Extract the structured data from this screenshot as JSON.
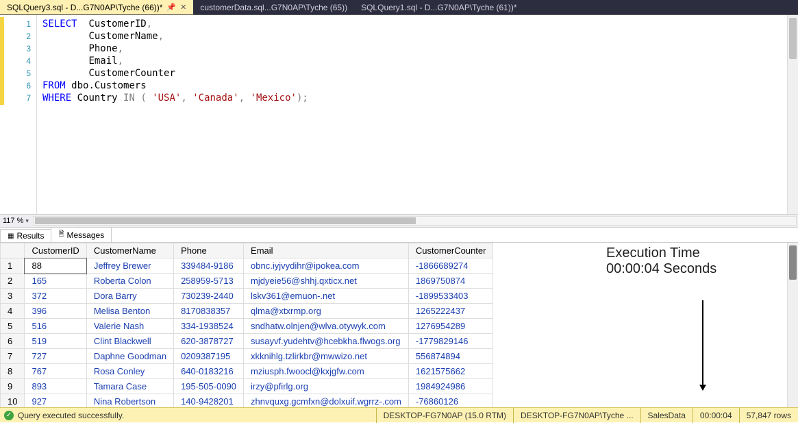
{
  "tabs": [
    {
      "label": "SQLQuery3.sql - D...G7N0AP\\Tyche (66))*",
      "active": true,
      "pinned": true
    },
    {
      "label": "customerData.sql...G7N0AP\\Tyche (65))",
      "active": false,
      "pinned": false
    },
    {
      "label": "SQLQuery1.sql - D...G7N0AP\\Tyche (61))*",
      "active": false,
      "pinned": false
    }
  ],
  "editor": {
    "lines": [
      1,
      2,
      3,
      4,
      5,
      6,
      7
    ],
    "sql": {
      "select": "SELECT",
      "cols": [
        "CustomerID",
        "CustomerName",
        "Phone",
        "Email",
        "CustomerCounter"
      ],
      "from": "FROM",
      "table": "dbo.Customers",
      "where": "WHERE",
      "whereCol": "Country",
      "in": "IN",
      "vals": [
        "'USA'",
        "'Canada'",
        "'Mexico'"
      ]
    }
  },
  "zoom": {
    "value": "117 %"
  },
  "resultsTabs": {
    "results": "Results",
    "messages": "Messages"
  },
  "grid": {
    "headers": [
      "",
      "CustomerID",
      "CustomerName",
      "Phone",
      "Email",
      "CustomerCounter"
    ],
    "rows": [
      {
        "n": "1",
        "CustomerID": "88",
        "CustomerName": "Jeffrey Brewer",
        "Phone": "339484-9186",
        "Email": "obnc.iyjvydihr@ipokea.com",
        "CustomerCounter": "-1866689274"
      },
      {
        "n": "2",
        "CustomerID": "165",
        "CustomerName": "Roberta Colon",
        "Phone": "258959-5713",
        "Email": "mjdyeie56@shhj.qxticx.net",
        "CustomerCounter": "1869750874"
      },
      {
        "n": "3",
        "CustomerID": "372",
        "CustomerName": "Dora Barry",
        "Phone": "730239-2440",
        "Email": "lskv361@emuon-.net",
        "CustomerCounter": "-1899533403"
      },
      {
        "n": "4",
        "CustomerID": "396",
        "CustomerName": "Melisa Benton",
        "Phone": "8170838357",
        "Email": "qlma@xtxrmp.org",
        "CustomerCounter": "1265222437"
      },
      {
        "n": "5",
        "CustomerID": "516",
        "CustomerName": "Valerie Nash",
        "Phone": "334-1938524",
        "Email": "sndhatw.olnjen@wlva.otywyk.com",
        "CustomerCounter": "1276954289"
      },
      {
        "n": "6",
        "CustomerID": "519",
        "CustomerName": "Clint Blackwell",
        "Phone": "620-3878727",
        "Email": "susayvf.yudehtv@hcebkha.flwogs.org",
        "CustomerCounter": "-1779829146"
      },
      {
        "n": "7",
        "CustomerID": "727",
        "CustomerName": "Daphne Goodman",
        "Phone": "0209387195",
        "Email": "xkknihlg.tzlirkbr@mwwizo.net",
        "CustomerCounter": "556874894"
      },
      {
        "n": "8",
        "CustomerID": "767",
        "CustomerName": "Rosa Conley",
        "Phone": "640-0183216",
        "Email": "mziusph.fwoocl@kxjgfw.com",
        "CustomerCounter": "1621575662"
      },
      {
        "n": "9",
        "CustomerID": "893",
        "CustomerName": "Tamara Case",
        "Phone": "195-505-0090",
        "Email": "irzy@pfirlg.org",
        "CustomerCounter": "1984924986"
      },
      {
        "n": "10",
        "CustomerID": "927",
        "CustomerName": "Nina Robertson",
        "Phone": "140-9428201",
        "Email": "zhnvquxg.gcmfxn@dolxuif.wgrrz-.com",
        "CustomerCounter": "-76860126"
      }
    ]
  },
  "annotation": {
    "line1": "Execution Time",
    "line2": "00:00:04 Seconds"
  },
  "status": {
    "message": "Query executed successfully.",
    "server": "DESKTOP-FG7N0AP (15.0 RTM)",
    "user": "DESKTOP-FG7N0AP\\Tyche ...",
    "db": "SalesData",
    "time": "00:00:04",
    "rows": "57,847 rows"
  }
}
